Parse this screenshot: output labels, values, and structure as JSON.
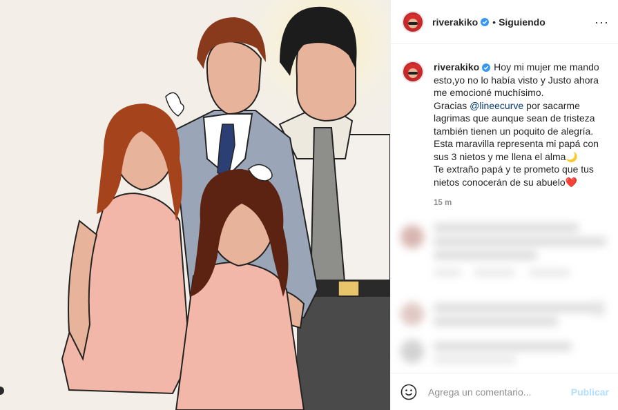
{
  "post": {
    "username": "riverakiko",
    "follow_status": "Siguiendo",
    "more_icon": "more-icon",
    "caption_text": "Hoy mi mujer me mando esto,yo no lo había visto y Justo ahora me emocioné muchísimo.\nGracias ",
    "mention": "@lineecurve",
    "caption_text_2": " por sacarme lagrimas que aunque sean de tristeza también tienen un poquito de alegría.\nEsta maravilla representa mi papá con sus 3 nietos y me llena el alma🌙\nTe extraño papá y te prometo que tus nietos conocerán de su abuelo❤️",
    "time_ago": "15 m"
  },
  "comment_box": {
    "placeholder": "Agrega un comentario...",
    "publish_label": "Publicar",
    "emoji_icon": "emoji-icon"
  },
  "colors": {
    "verified_blue": "#3897f0",
    "mention_blue": "#00376b",
    "publish_disabled": "#b2dffc",
    "art_background": "#f3efe8",
    "dress_pink": "#f2b7a8",
    "hair_brown": "#8a3a1c",
    "suit_grey": "#9aa6b8",
    "skin": "#e7b39a"
  }
}
